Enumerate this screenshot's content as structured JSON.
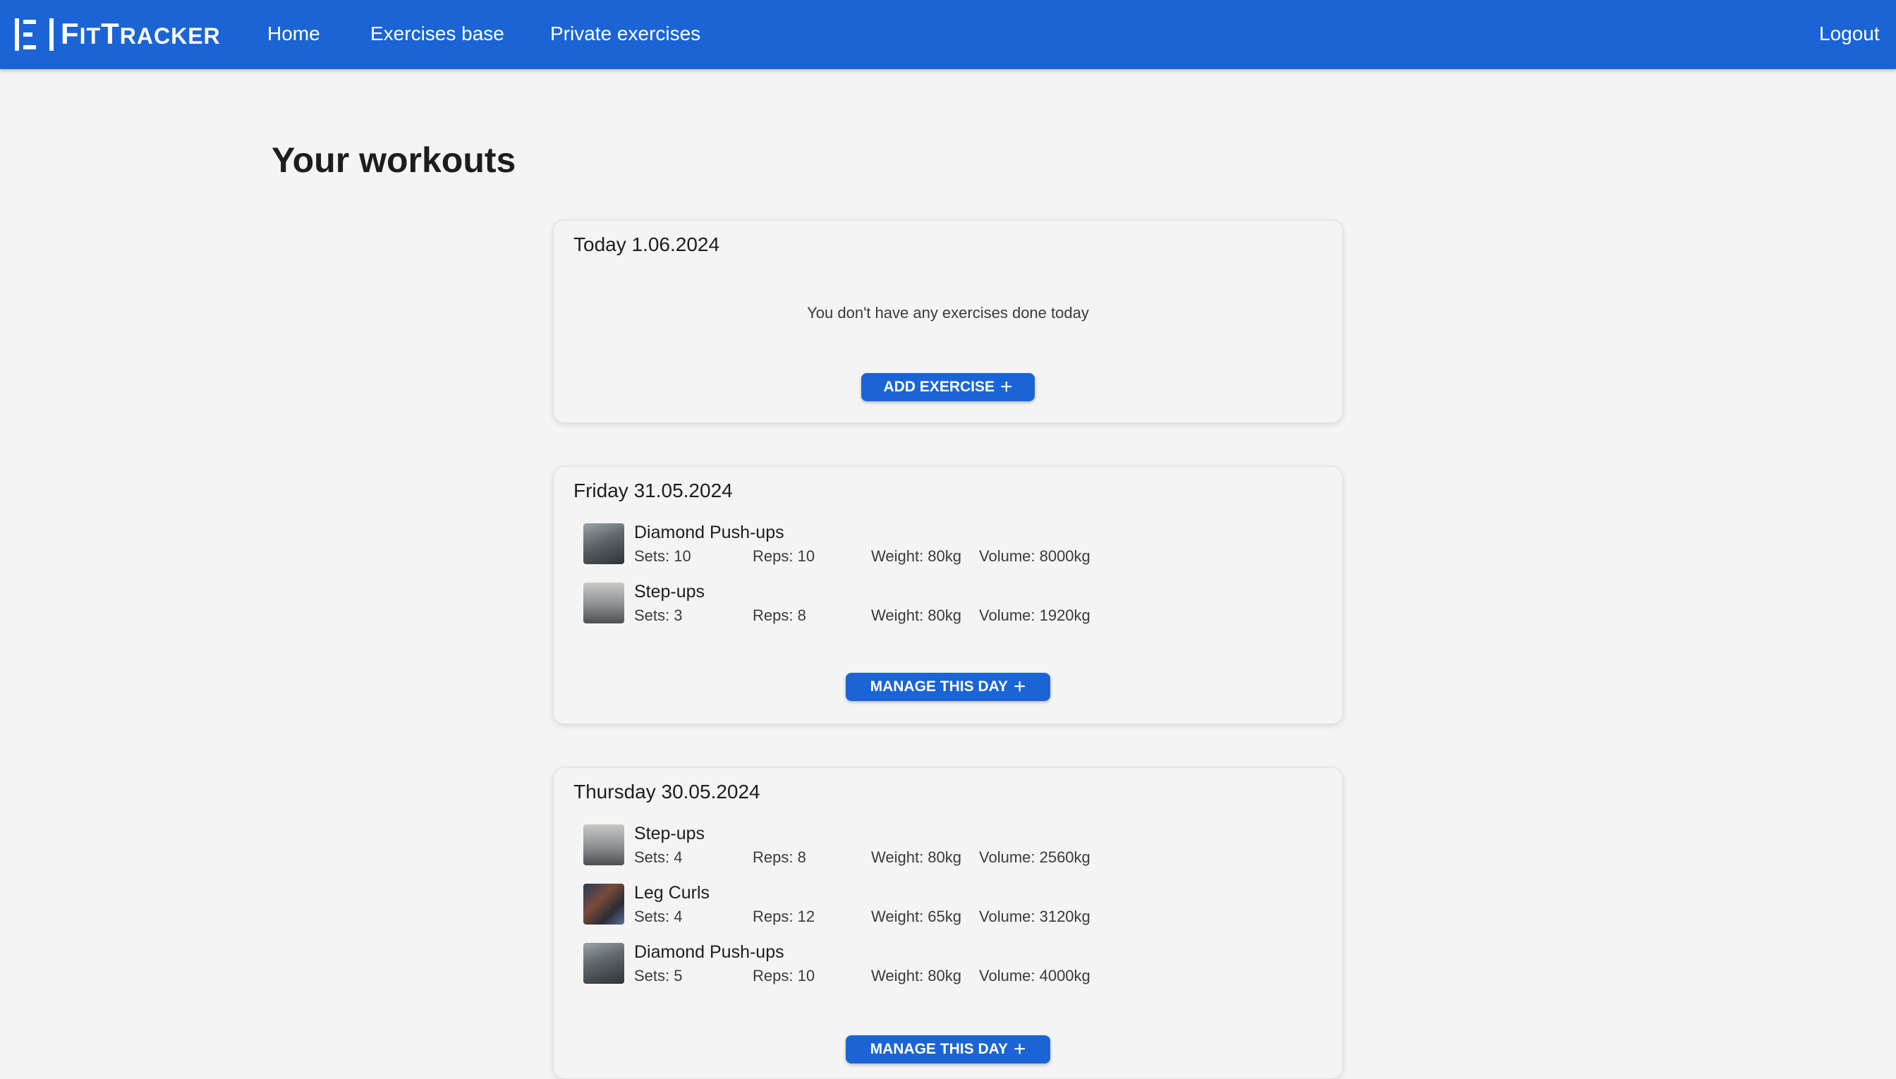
{
  "header": {
    "logo_text_big1": "F",
    "logo_text_small1": "IT",
    "logo_text_big2": "T",
    "logo_text_small2": "RACKER",
    "nav": {
      "home": "Home",
      "exercises_base": "Exercises base",
      "private_exercises": "Private exercises",
      "logout": "Logout"
    },
    "brand_color": "#1a64d6"
  },
  "page_title": "Your workouts",
  "days": [
    {
      "title": "Today 1.06.2024",
      "empty_message": "You don't have any exercises done today",
      "button_label": "ADD EXERCISE",
      "exercises": []
    },
    {
      "title": "Friday 31.05.2024",
      "button_label": "MANAGE THIS DAY",
      "exercises": [
        {
          "name": "Diamond Push-ups",
          "sets": "Sets: 10",
          "reps": "Reps: 10",
          "weight": "Weight: 80kg",
          "volume": "Volume: 8000kg"
        },
        {
          "name": "Step-ups",
          "sets": "Sets: 3",
          "reps": "Reps: 8",
          "weight": "Weight: 80kg",
          "volume": "Volume: 1920kg"
        }
      ]
    },
    {
      "title": "Thursday 30.05.2024",
      "button_label": "MANAGE THIS DAY",
      "exercises": [
        {
          "name": "Step-ups",
          "sets": "Sets: 4",
          "reps": "Reps: 8",
          "weight": "Weight: 80kg",
          "volume": "Volume: 2560kg"
        },
        {
          "name": "Leg Curls",
          "sets": "Sets: 4",
          "reps": "Reps: 12",
          "weight": "Weight: 65kg",
          "volume": "Volume: 3120kg"
        },
        {
          "name": "Diamond Push-ups",
          "sets": "Sets: 5",
          "reps": "Reps: 10",
          "weight": "Weight: 80kg",
          "volume": "Volume: 4000kg"
        }
      ]
    }
  ],
  "icons": {
    "plus": "plus-icon"
  }
}
